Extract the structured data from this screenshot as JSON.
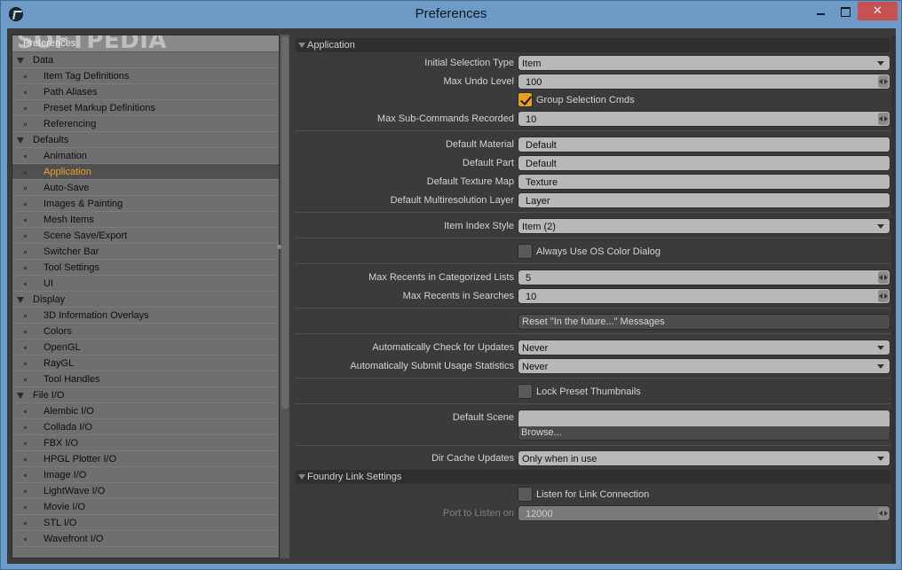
{
  "window": {
    "title": "Preferences"
  },
  "tree": {
    "header": "Preferences",
    "watermark": "SOFTPEDIA",
    "rows": [
      {
        "type": "group",
        "label": "Data"
      },
      {
        "type": "item",
        "label": "Item Tag Definitions"
      },
      {
        "type": "item",
        "label": "Path Aliases"
      },
      {
        "type": "item",
        "label": "Preset Markup Definitions"
      },
      {
        "type": "item",
        "label": "Referencing"
      },
      {
        "type": "group",
        "label": "Defaults"
      },
      {
        "type": "item",
        "label": "Animation"
      },
      {
        "type": "item",
        "label": "Application",
        "selected": true
      },
      {
        "type": "item",
        "label": "Auto-Save"
      },
      {
        "type": "item",
        "label": "Images & Painting"
      },
      {
        "type": "item",
        "label": "Mesh Items"
      },
      {
        "type": "item",
        "label": "Scene Save/Export"
      },
      {
        "type": "item",
        "label": "Switcher Bar"
      },
      {
        "type": "item",
        "label": "Tool Settings"
      },
      {
        "type": "item",
        "label": "UI"
      },
      {
        "type": "group",
        "label": "Display"
      },
      {
        "type": "item",
        "label": "3D Information Overlays"
      },
      {
        "type": "item",
        "label": "Colors"
      },
      {
        "type": "item",
        "label": "OpenGL"
      },
      {
        "type": "item",
        "label": "RayGL"
      },
      {
        "type": "item",
        "label": "Tool Handles"
      },
      {
        "type": "group",
        "label": "File I/O"
      },
      {
        "type": "item",
        "label": "Alembic I/O"
      },
      {
        "type": "item",
        "label": "Collada I/O"
      },
      {
        "type": "item",
        "label": "FBX I/O"
      },
      {
        "type": "item",
        "label": "HPGL Plotter I/O"
      },
      {
        "type": "item",
        "label": "Image I/O"
      },
      {
        "type": "item",
        "label": "LightWave I/O"
      },
      {
        "type": "item",
        "label": "Movie I/O"
      },
      {
        "type": "item",
        "label": "STL I/O"
      },
      {
        "type": "item",
        "label": "Wavefront I/O"
      }
    ]
  },
  "application": {
    "section_title": "Application",
    "initial_selection_type": {
      "label": "Initial Selection Type",
      "value": "Item"
    },
    "max_undo_level": {
      "label": "Max Undo Level",
      "value": "100"
    },
    "group_selection_cmds": {
      "label": "Group Selection Cmds",
      "checked": true
    },
    "max_sub_commands": {
      "label": "Max Sub-Commands Recorded",
      "value": "10"
    },
    "default_material": {
      "label": "Default Material",
      "value": "Default"
    },
    "default_part": {
      "label": "Default Part",
      "value": "Default"
    },
    "default_texture_map": {
      "label": "Default Texture Map",
      "value": "Texture"
    },
    "default_multires_layer": {
      "label": "Default Multiresolution Layer",
      "value": "Layer"
    },
    "item_index_style": {
      "label": "Item Index Style",
      "value": "Item (2)"
    },
    "always_os_color": {
      "label": "Always Use OS Color Dialog",
      "checked": false
    },
    "max_recents_categorized": {
      "label": "Max Recents in Categorized Lists",
      "value": "5"
    },
    "max_recents_searches": {
      "label": "Max Recents in Searches",
      "value": "10"
    },
    "reset_messages": {
      "label": "Reset \"In the future...\" Messages"
    },
    "auto_check_updates": {
      "label": "Automatically Check for Updates",
      "value": "Never"
    },
    "auto_submit_stats": {
      "label": "Automatically Submit Usage Statistics",
      "value": "Never"
    },
    "lock_preset_thumbs": {
      "label": "Lock Preset Thumbnails",
      "checked": false
    },
    "default_scene": {
      "label": "Default Scene",
      "value": "",
      "browse": "Browse..."
    },
    "dir_cache_updates": {
      "label": "Dir Cache Updates",
      "value": "Only when in use"
    }
  },
  "foundry_link": {
    "section_title": "Foundry Link Settings",
    "listen": {
      "label": "Listen for Link Connection",
      "checked": false
    },
    "port": {
      "label": "Port to Listen on",
      "value": "12000"
    }
  }
}
